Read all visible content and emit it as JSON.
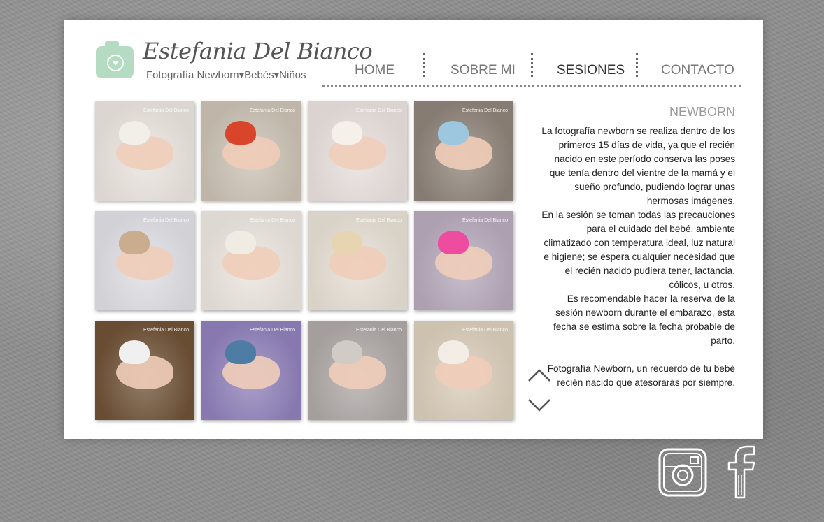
{
  "brand": {
    "name": "Estefania Del Bianco",
    "tagline": "Fotografía Newborn▾Bebés▾Niños"
  },
  "nav": {
    "items": [
      {
        "label": "HOME",
        "active": false
      },
      {
        "label": "SOBRE MI",
        "active": false
      },
      {
        "label": "SESIONES",
        "active": true
      },
      {
        "label": "CONTACTO",
        "active": false
      }
    ]
  },
  "section": {
    "title": "NEWBORN",
    "paragraphs": [
      "La fotografía newborn se realiza dentro de los primeros 15 días de vida, ya que el recién nacido en este período conserva las poses que tenía dentro del vientre de la mamá y el sueño profundo, pudiendo lograr unas hermosas imágenes.",
      "En la sesión se toman todas las precauciones para el cuidado del bebé, ambiente climatizado con temperatura ideal, luz natural e higiene; se espera cualquier necesidad que el recién nacido pudiera tener, lactancia, cólicos, u otros.",
      "Es recomendable hacer la reserva de la sesión newborn durante el embarazo, esta fecha se estima sobre la fecha probable de parto."
    ],
    "closing": "Fotografía Newborn, un recuerdo de tu bebé recién nacido que atesorarás por siempre."
  },
  "gallery": {
    "watermark": "Estefania Del Bianco",
    "photos": [
      {
        "bg": "#e8e2dc",
        "hat": "#f2efe8"
      },
      {
        "bg": "#c9c0b2",
        "hat": "#d8452b"
      },
      {
        "bg": "#e6dedb",
        "hat": "#f5f1ea"
      },
      {
        "bg": "#8d8278",
        "hat": "#9cc7de"
      },
      {
        "bg": "#dcdce2",
        "hat": "#c9ad8e"
      },
      {
        "bg": "#e9e3dc",
        "hat": "#f0ece4"
      },
      {
        "bg": "#e4ddd2",
        "hat": "#e6d5b0"
      },
      {
        "bg": "#b5a8ba",
        "hat": "#ee4c9e"
      },
      {
        "bg": "#6e5136",
        "hat": "#f0f0f0"
      },
      {
        "bg": "#8e7fb8",
        "hat": "#4d7ca5"
      },
      {
        "bg": "#ada7a5",
        "hat": "#d0cbc4"
      },
      {
        "bg": "#d8cbb8",
        "hat": "#f2ede5"
      }
    ]
  },
  "icons": {
    "scroll_up": "chevron-up-icon",
    "scroll_down": "chevron-down-icon",
    "instagram": "instagram-icon",
    "facebook": "facebook-icon"
  }
}
